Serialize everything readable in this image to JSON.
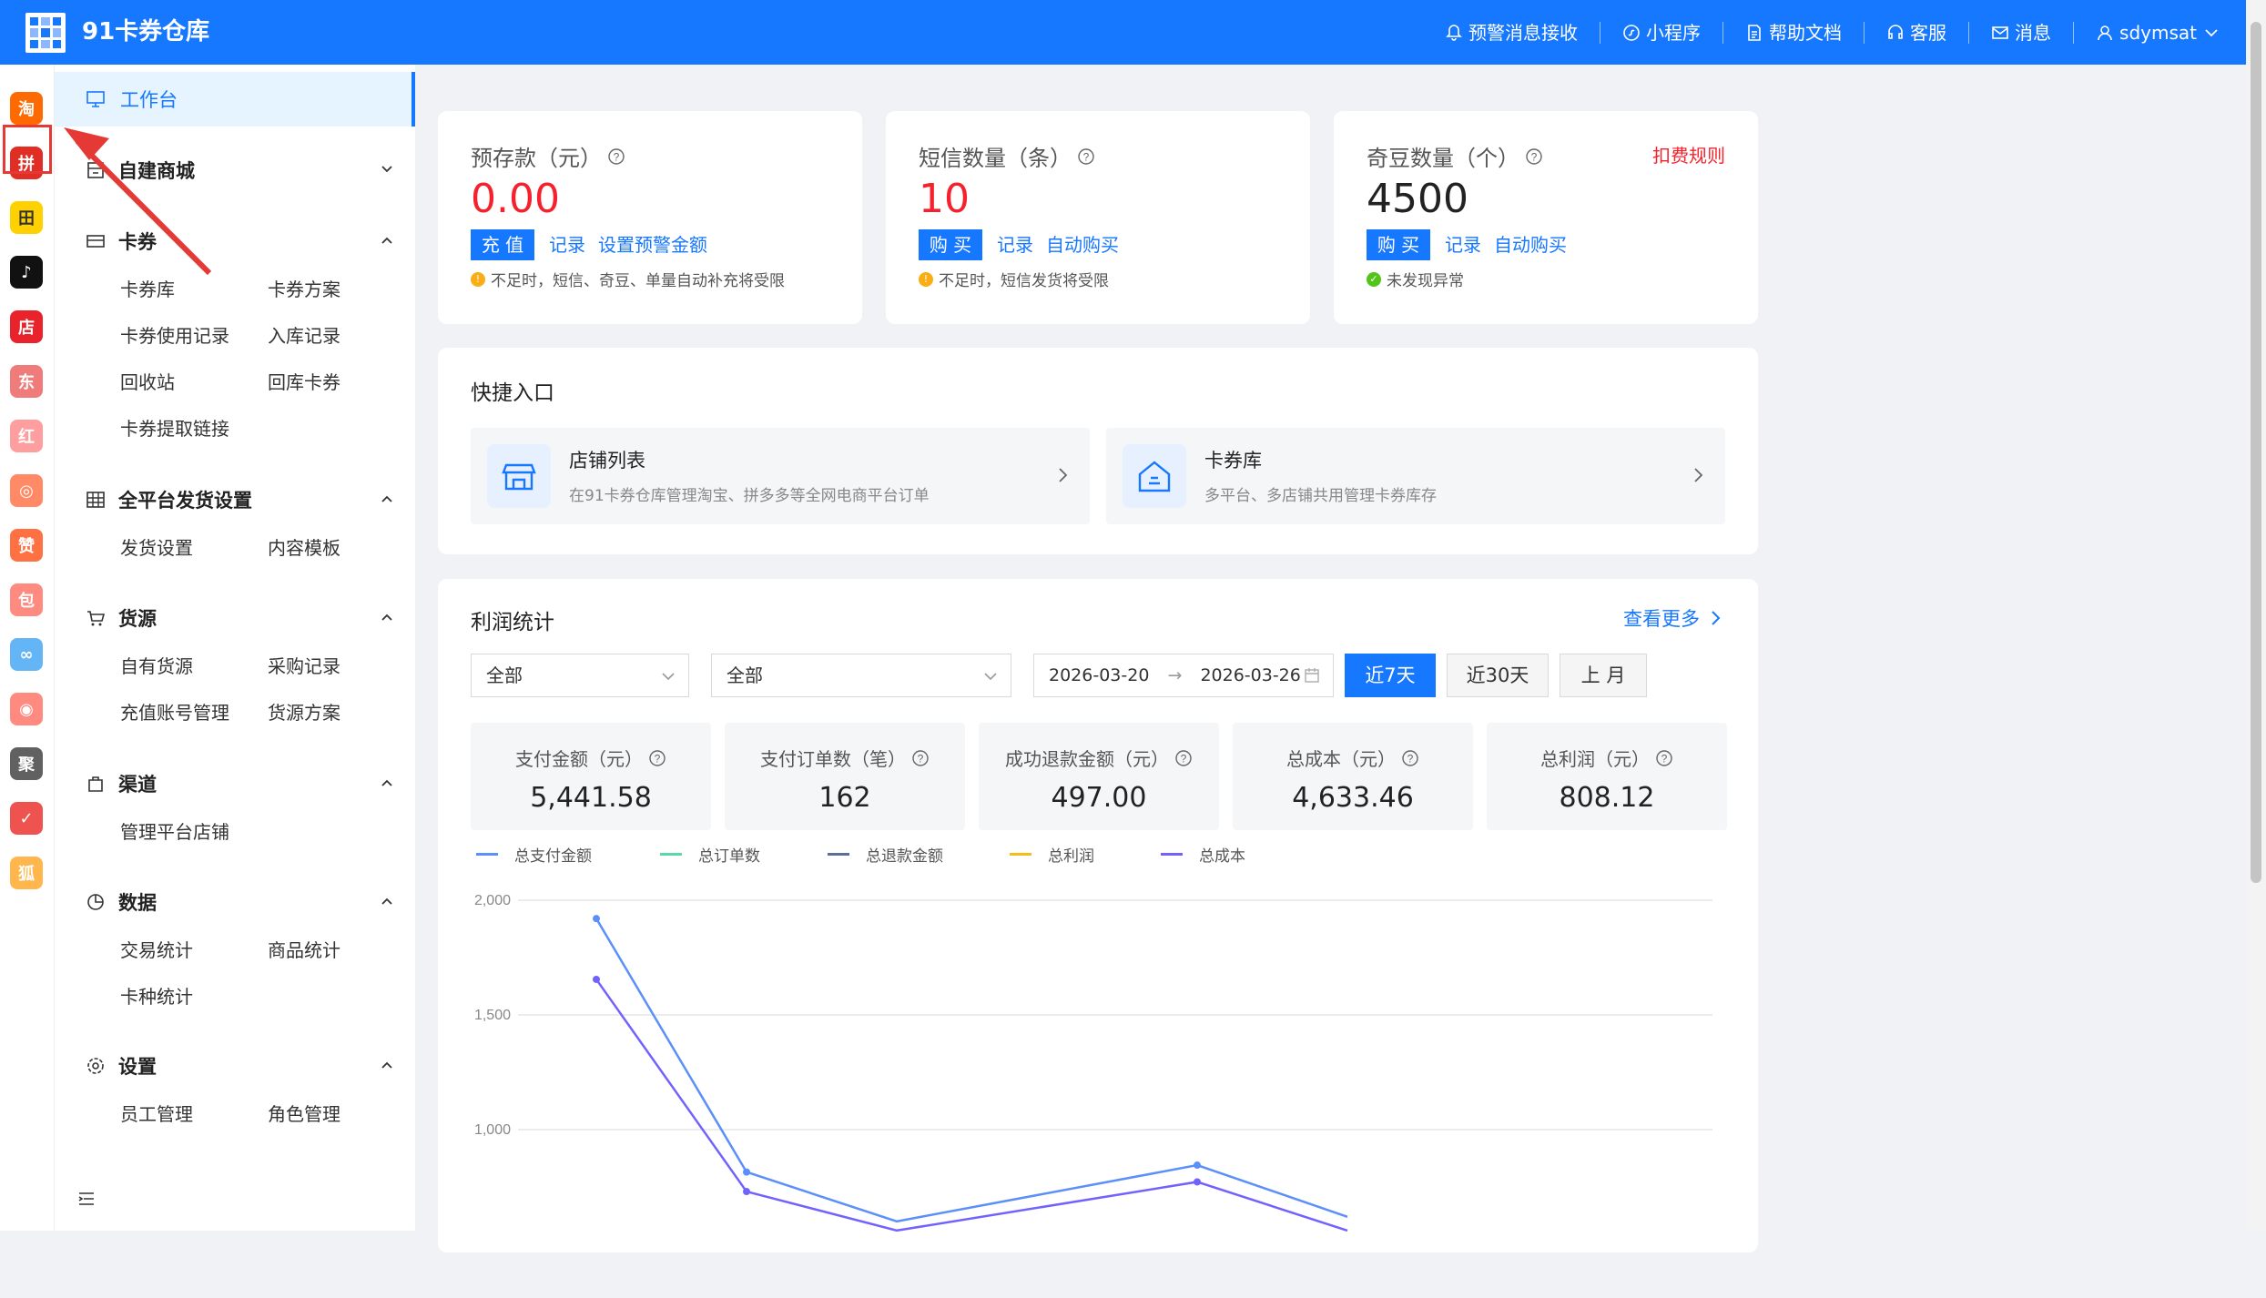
{
  "header": {
    "app_title": "91卡券仓库",
    "nav": [
      {
        "label": "预警消息接收",
        "icon": "bell-icon"
      },
      {
        "label": "小程序",
        "icon": "miniprogram-icon"
      },
      {
        "label": "帮助文档",
        "icon": "document-icon"
      },
      {
        "label": "客服",
        "icon": "headset-icon"
      },
      {
        "label": "消息",
        "icon": "mail-icon"
      },
      {
        "label": "sdymsat",
        "icon": "user-icon"
      }
    ]
  },
  "rail": {
    "apps": [
      {
        "glyph": "淘",
        "color": "#ff6a00"
      },
      {
        "glyph": "拼",
        "color": "#e02e24"
      },
      {
        "glyph": "田",
        "color": "#ffd100"
      },
      {
        "glyph": "♪",
        "color": "#111111"
      },
      {
        "glyph": "店",
        "color": "#e8232b"
      },
      {
        "glyph": "东",
        "color": "#f07b7b"
      },
      {
        "glyph": "红",
        "color": "#ff9e9e"
      },
      {
        "glyph": "◎",
        "color": "#ff8a65"
      },
      {
        "glyph": "赞",
        "color": "#ff7043"
      },
      {
        "glyph": "包",
        "color": "#ff8a80"
      },
      {
        "glyph": "∞",
        "color": "#64b5f6"
      },
      {
        "glyph": "◉",
        "color": "#ff8a80"
      },
      {
        "glyph": "聚",
        "color": "#616161"
      },
      {
        "glyph": "✓",
        "color": "#ef5350"
      },
      {
        "glyph": "狐",
        "color": "#ffb74d"
      }
    ]
  },
  "sidebar": {
    "workbench": "工作台",
    "groups": [
      {
        "label": "自建商城",
        "items": []
      },
      {
        "label": "卡券",
        "items": [
          "卡券库",
          "卡券方案",
          "卡券使用记录",
          "入库记录",
          "回收站",
          "回库卡券",
          "卡券提取链接"
        ]
      },
      {
        "label": "全平台发货设置",
        "items": [
          "发货设置",
          "内容模板"
        ]
      },
      {
        "label": "货源",
        "items": [
          "自有货源",
          "采购记录",
          "充值账号管理",
          "货源方案"
        ]
      },
      {
        "label": "渠道",
        "items": [
          "管理平台店铺"
        ]
      },
      {
        "label": "数据",
        "items": [
          "交易统计",
          "商品统计",
          "卡种统计"
        ]
      },
      {
        "label": "设置",
        "items": [
          "员工管理",
          "角色管理"
        ]
      }
    ]
  },
  "kpis": [
    {
      "label": "预存款（元）",
      "value": "0.00",
      "value_color": "#f5222d",
      "button": "充 值",
      "links": [
        "记录",
        "设置预警金额"
      ],
      "note": "不足时，短信、奇豆、单量自动补充将受限",
      "note_type": "warning"
    },
    {
      "label": "短信数量（条）",
      "value": "10",
      "value_color": "#f5222d",
      "button": "购 买",
      "links": [
        "记录",
        "自动购买"
      ],
      "note": "不足时，短信发货将受限",
      "note_type": "warning"
    },
    {
      "label": "奇豆数量（个）",
      "value": "4500",
      "value_color": "#222222",
      "button": "购 买",
      "links": [
        "记录",
        "自动购买"
      ],
      "note": "未发现异常",
      "note_type": "ok",
      "extra_link": "扣费规则"
    }
  ],
  "quick": {
    "title": "快捷入口",
    "items": [
      {
        "title": "店铺列表",
        "desc": "在91卡券仓库管理淘宝、拼多多等全网电商平台订单",
        "icon": "store-icon"
      },
      {
        "title": "卡券库",
        "desc": "多平台、多店铺共用管理卡券库存",
        "icon": "warehouse-icon"
      }
    ]
  },
  "profit": {
    "title": "利润统计",
    "more": "查看更多",
    "filter1": "全部",
    "filter2": "全部",
    "date_start": "2026-03-20",
    "date_end": "2026-03-26",
    "ranges": [
      "近7天",
      "近30天",
      "上 月"
    ],
    "active_range": 0,
    "stats": [
      {
        "label": "支付金额（元）",
        "value": "5,441.58"
      },
      {
        "label": "支付订单数（笔）",
        "value": "162"
      },
      {
        "label": "成功退款金额（元）",
        "value": "497.00"
      },
      {
        "label": "总成本（元）",
        "value": "4,633.46"
      },
      {
        "label": "总利润（元）",
        "value": "808.12"
      }
    ]
  },
  "chart_data": {
    "type": "line",
    "legend": [
      "总支付金额",
      "总订单数",
      "总退款金额",
      "总利润",
      "总成本"
    ],
    "legend_colors": [
      "#5b8ff9",
      "#5ad8a6",
      "#5d7092",
      "#f6bd16",
      "#7262fd"
    ],
    "y_ticks": [
      "2,000",
      "1,500",
      "1,000"
    ],
    "ylim": [
      1000,
      2000
    ],
    "series": [
      {
        "name": "总支付金额",
        "color": "#5b8ff9",
        "values": [
          1920,
          815,
          600,
          null,
          845,
          620
        ]
      },
      {
        "name": "总成本",
        "color": "#7262fd",
        "values": [
          1655,
          730,
          560,
          null,
          772,
          560
        ]
      }
    ]
  }
}
